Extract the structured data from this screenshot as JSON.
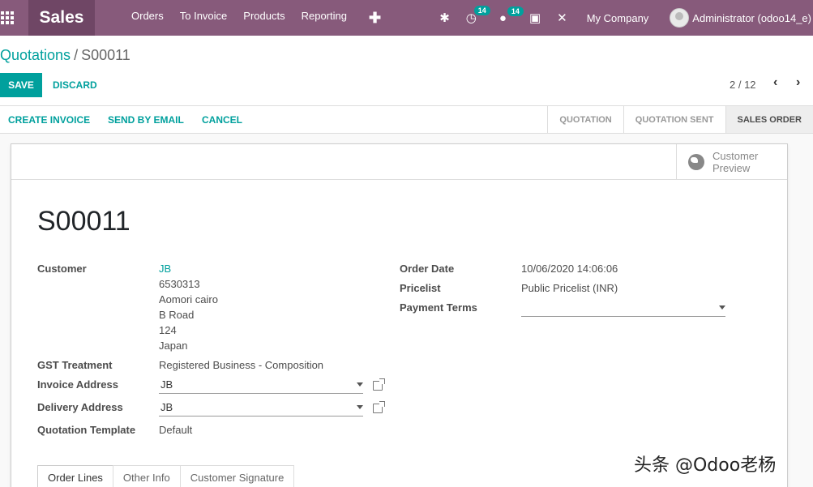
{
  "navbar": {
    "app_name": "Sales",
    "menu": [
      "Orders",
      "To Invoice",
      "Products",
      "Reporting"
    ],
    "plus": "✚",
    "activity_count": "14",
    "messages_count": "14",
    "company": "My Company",
    "user": "Administrator (odoo14_e)"
  },
  "breadcrumb": {
    "parent": "Quotations",
    "separator": "/",
    "current": "S00011"
  },
  "control": {
    "save_label": "SAVE",
    "discard_label": "DISCARD",
    "pager": "2 / 12"
  },
  "statusbar": {
    "buttons": [
      "CREATE INVOICE",
      "SEND BY EMAIL",
      "CANCEL"
    ],
    "stages": [
      "QUOTATION",
      "QUOTATION SENT",
      "SALES ORDER"
    ],
    "active_stage": "SALES ORDER"
  },
  "sheet": {
    "preview_line1": "Customer",
    "preview_line2": "Preview",
    "title": "S00011",
    "customer_label": "Customer",
    "customer_name": "JB",
    "address": [
      "6530313",
      "Aomori cairo",
      "B Road",
      "124",
      "Japan"
    ],
    "gst_label": "GST Treatment",
    "gst_value": "Registered Business - Composition",
    "invoice_address_label": "Invoice Address",
    "invoice_address_value": "JB",
    "delivery_address_label": "Delivery Address",
    "delivery_address_value": "JB",
    "template_label": "Quotation Template",
    "template_value": "Default",
    "order_date_label": "Order Date",
    "order_date_value": "10/06/2020 14:06:06",
    "pricelist_label": "Pricelist",
    "pricelist_value": "Public Pricelist (INR)",
    "payment_terms_label": "Payment Terms",
    "payment_terms_value": ""
  },
  "tabs": [
    "Order Lines",
    "Other Info",
    "Customer Signature"
  ],
  "watermark": "头条 @Odoo老杨"
}
